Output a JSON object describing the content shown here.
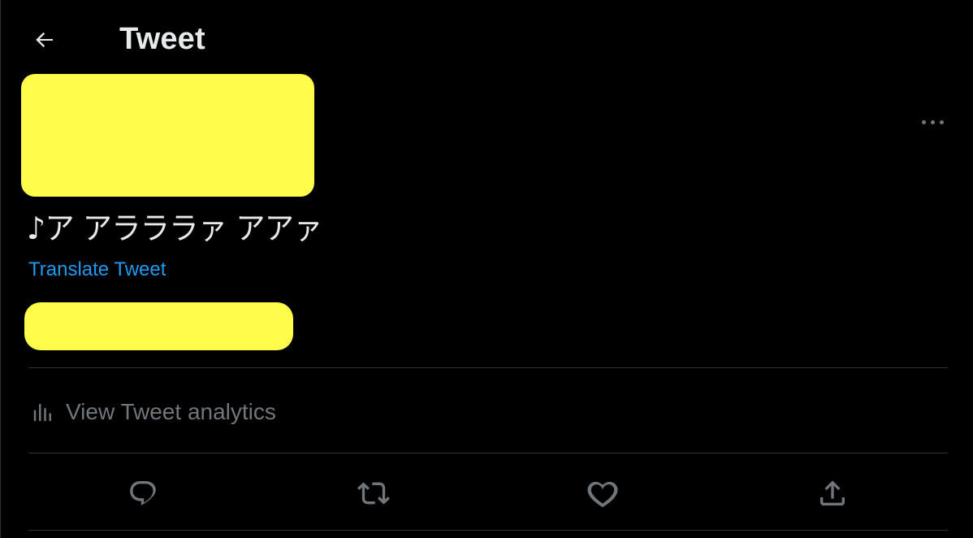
{
  "header": {
    "back_icon": "arrow-left-icon",
    "title": "Tweet"
  },
  "tweet": {
    "more_icon": "more-horizontal-icon",
    "text": "♪ア アラララァ アアァ",
    "translate_label": "Translate Tweet"
  },
  "analytics": {
    "icon": "bar-chart-icon",
    "label": "View Tweet analytics"
  },
  "actions": [
    {
      "icon": "reply-icon"
    },
    {
      "icon": "retweet-icon"
    },
    {
      "icon": "like-icon"
    },
    {
      "icon": "share-icon"
    }
  ],
  "colors": {
    "background": "#000000",
    "text": "#e7e9ea",
    "secondary_text": "#71767b",
    "link": "#1d9bf0",
    "divider": "#2f3336",
    "redaction": "#fffc4c"
  }
}
